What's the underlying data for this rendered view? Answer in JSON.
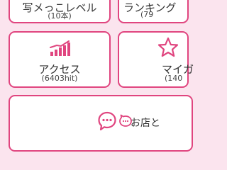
{
  "menu": {
    "top_left": {
      "title": "写メっこレベル",
      "subtitle": "(10本)"
    },
    "top_right": {
      "title": "ランキング",
      "subtitle": "(79"
    },
    "access": {
      "title": "アクセス",
      "subtitle": "(6403hit)",
      "icon": "bar-chart-icon"
    },
    "my_gallery": {
      "title": "マイガ",
      "subtitle": "(140",
      "icon": "star-icon"
    },
    "shop_chat": {
      "label": "お店と",
      "icon": "chat-bubbles-icon"
    }
  },
  "colors": {
    "accent": "#e0457f",
    "background": "#fbe4ee",
    "card": "#ffffff",
    "text": "#333333"
  }
}
